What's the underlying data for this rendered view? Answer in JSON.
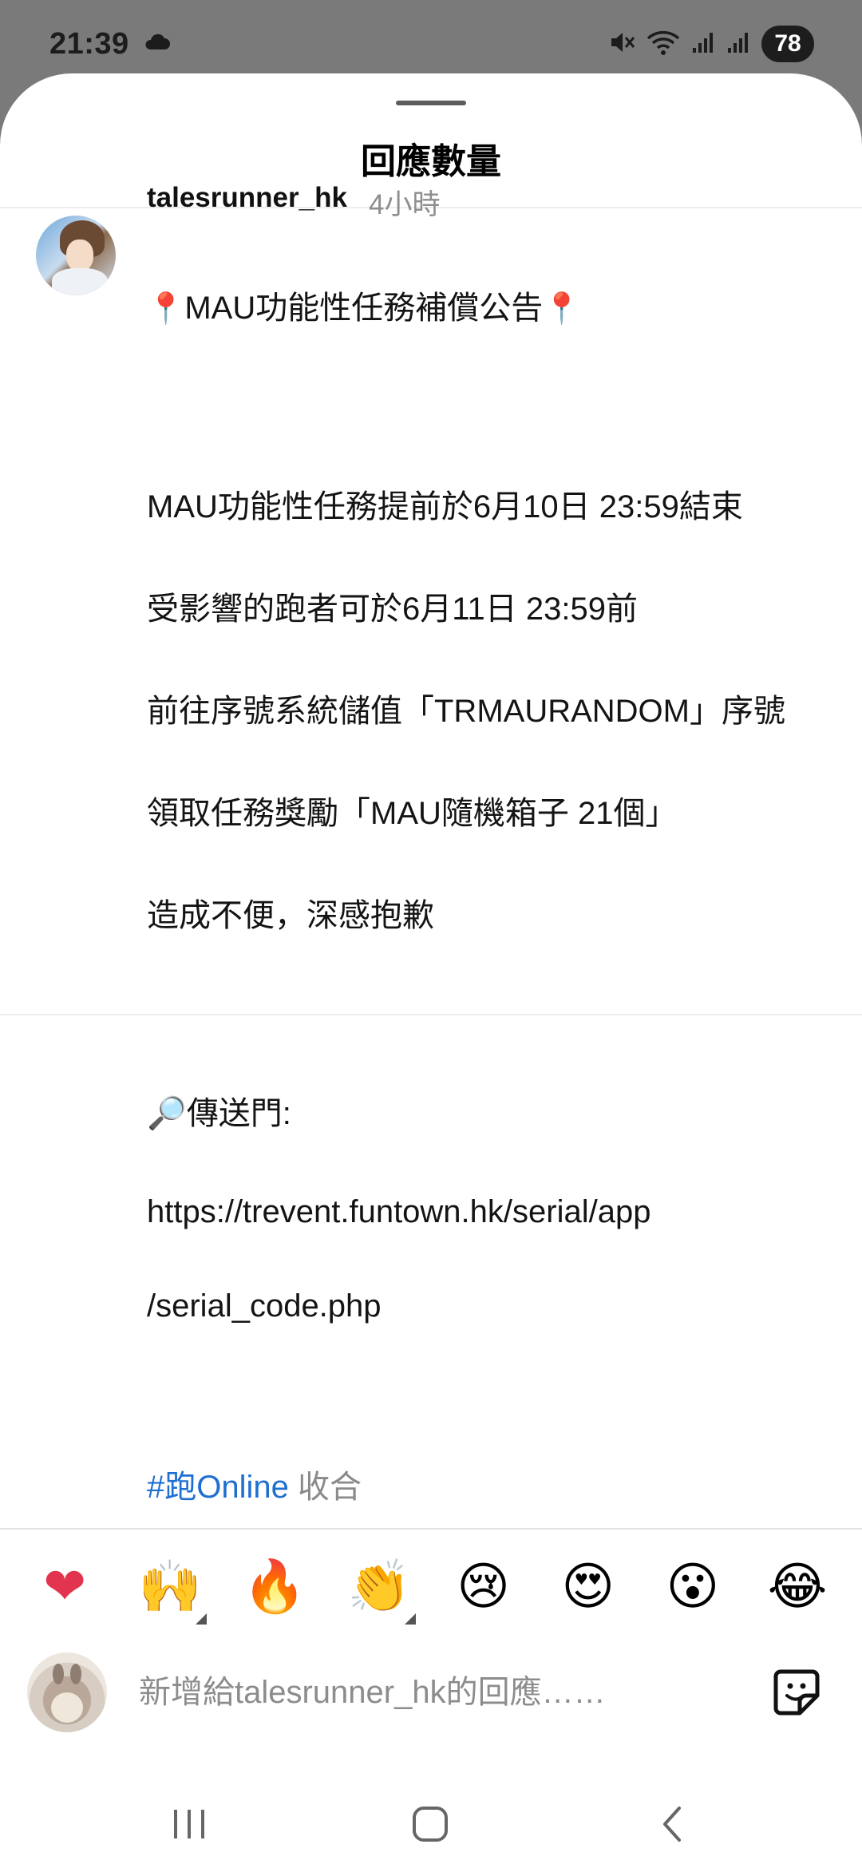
{
  "status_bar": {
    "time": "21:39",
    "battery": "78",
    "icons": [
      "cloud-icon",
      "mute-icon",
      "wifi-icon",
      "signal-icon",
      "signal-icon",
      "battery-icon"
    ]
  },
  "sheet": {
    "title": "回應數量"
  },
  "post": {
    "username": "talesrunner_hk",
    "timestamp": "4小時",
    "title_line": "MAU功能性任務補償公告",
    "lines": [
      "MAU功能性任務提前於6月10日 23:59結束",
      "受影響的跑者可於6月11日 23:59前",
      "前往序號系統儲值「TRMAURANDOM」序號",
      "領取任務獎勵「MAU隨機箱子 21個」",
      "造成不便，深感抱歉"
    ],
    "portal_label": "傳送門:",
    "link_line1": "https://trevent.funtown.hk/serial/app",
    "link_line2": "/serial_code.php",
    "hashtag": "#跑Online",
    "collapse_label": "收合"
  },
  "reactions": [
    {
      "name": "heart",
      "glyph": "❤"
    },
    {
      "name": "raising-hands",
      "glyph": "🙌"
    },
    {
      "name": "fire",
      "glyph": "🔥"
    },
    {
      "name": "clapping-hands",
      "glyph": "👏"
    },
    {
      "name": "crying-face",
      "glyph": "😢"
    },
    {
      "name": "heart-eyes",
      "glyph": "😍"
    },
    {
      "name": "surprised-face",
      "glyph": "😮"
    },
    {
      "name": "tears-of-joy",
      "glyph": "😂"
    }
  ],
  "composer": {
    "placeholder": "新增給talesrunner_hk的回應……"
  },
  "colors": {
    "link": "#1f6fd1",
    "muted": "#8e8e8e",
    "heart": "#e3344f"
  }
}
